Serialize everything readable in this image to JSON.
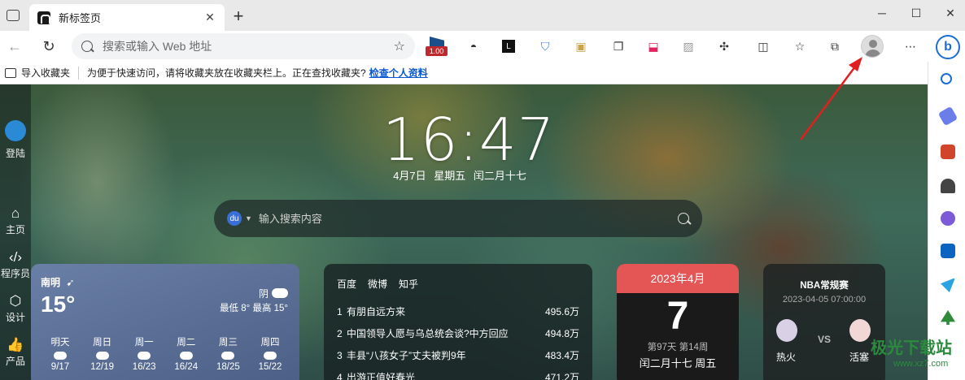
{
  "browser": {
    "tab_title": "新标签页",
    "tab_close": "✕",
    "new_tab": "+",
    "address_placeholder": "搜索或输入 Web 地址",
    "extension_badge": "1.00",
    "window_controls": {
      "minimize": "─",
      "maximize": "☐",
      "close": "✕"
    }
  },
  "favorites_bar": {
    "import_label": "导入收藏夹",
    "message": "为便于快速访问，请将收藏夹放在收藏夹栏上。正在查找收藏夹?",
    "link": "检查个人资料"
  },
  "left_rail": {
    "login": "登陆",
    "home": "主页",
    "programmer": "程序员",
    "design": "设计",
    "product": "产品"
  },
  "clock": {
    "time": "16:47",
    "date": "4月7日 星期五 闰二月十七"
  },
  "search": {
    "placeholder": "输入搜索内容",
    "engine_label": "du"
  },
  "weather": {
    "city": "南明",
    "temp": "15°",
    "condition": "阴",
    "range": "最低 8° 最高 15°",
    "forecast": [
      {
        "day": "明天",
        "temp": "9/17"
      },
      {
        "day": "周日",
        "temp": "12/19"
      },
      {
        "day": "周一",
        "temp": "16/23"
      },
      {
        "day": "周二",
        "temp": "16/24"
      },
      {
        "day": "周三",
        "temp": "18/25"
      },
      {
        "day": "周四",
        "temp": "15/22"
      }
    ]
  },
  "hotlist": {
    "tabs": [
      "百度",
      "微博",
      "知乎"
    ],
    "items": [
      {
        "idx": "1",
        "title": "有朋自远方来",
        "count": "495.6万"
      },
      {
        "idx": "2",
        "title": "中国领导人愿与乌总统会谈?中方回应",
        "count": "494.8万"
      },
      {
        "idx": "3",
        "title": "丰县“八孩女子”丈夫被判9年",
        "count": "483.4万"
      },
      {
        "idx": "4",
        "title": "出游正值好春光",
        "count": "471.2万"
      }
    ]
  },
  "calendar": {
    "month": "2023年4月",
    "day": "7",
    "week_info": "第97天 第14周",
    "lunar": "闰二月十七 周五"
  },
  "nba": {
    "title": "NBA常规赛",
    "datetime": "2023-04-05 07:00:00",
    "vs": "VS",
    "home": "热火",
    "away": "活塞"
  },
  "watermark": {
    "main": "极光下载站",
    "sub": "www.xz7.com"
  },
  "colors": {
    "calendar_header": "#e45656",
    "link": "#0b57d0",
    "annotation_arrow": "#e02020",
    "bing": "#1b6fd4"
  }
}
